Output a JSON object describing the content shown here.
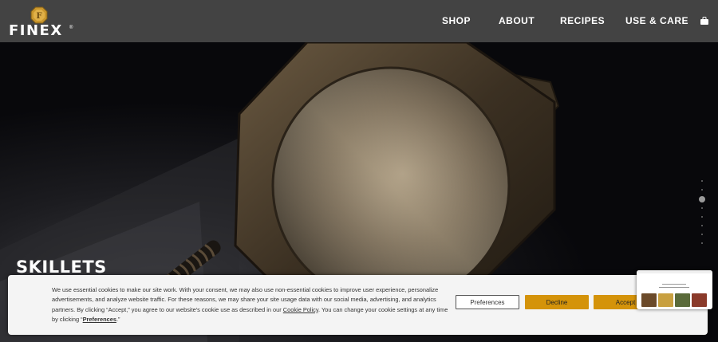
{
  "brand": {
    "name": "FINEX",
    "mark": "®",
    "emblem": "F"
  },
  "nav": {
    "items": [
      "SHOP",
      "ABOUT",
      "RECIPES",
      "USE & CARE"
    ],
    "cart_icon": "cart-icon"
  },
  "hero": {
    "title": "SKILLETS",
    "slide_count": 8,
    "active_slide": 3
  },
  "cookie": {
    "text_before": "We use essential cookies to make our site work. With your consent, we may also use non-essential cookies to improve user experience, personalize advertisements, and analyze website traffic. For these reasons, we may share your site usage data with our social media, advertising, and analytics partners. By clicking “Accept,” you agree to our website's cookie use as described in our ",
    "policy_link": "Cookie Policy",
    "text_middle": ". You can change your cookie settings at any time by clicking “",
    "preferences_link": "Preferences",
    "text_end": ".”",
    "buttons": {
      "preferences": "Preferences",
      "decline": "Decline",
      "accept": "Accept"
    }
  },
  "colors": {
    "navbar": "#434343",
    "accent": "#d4930a",
    "banner_bg": "#f4f4f4"
  }
}
